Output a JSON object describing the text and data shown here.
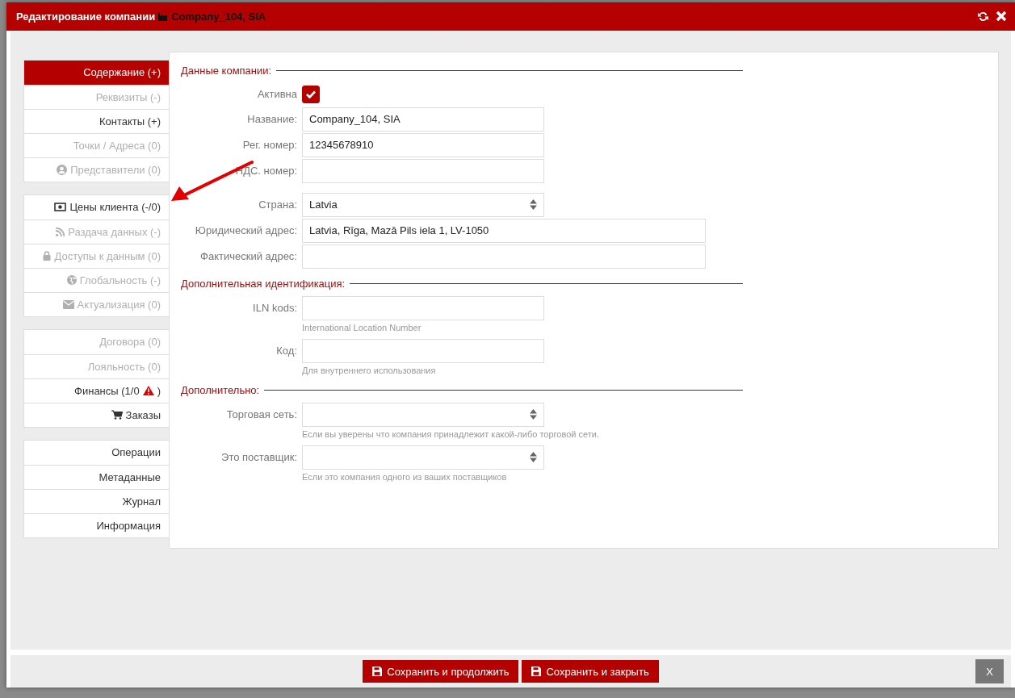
{
  "window": {
    "title": "Редактирование компании",
    "subject": "Company_104, SIA"
  },
  "sidebar": {
    "groups": [
      [
        {
          "label": "Содержание (+)",
          "selected": true,
          "disabled": false
        },
        {
          "label": "Реквизиты (-)",
          "selected": false,
          "disabled": true
        },
        {
          "label": "Контакты (+)",
          "selected": false,
          "disabled": false
        },
        {
          "label": "Точки / Адреса (0)",
          "selected": false,
          "disabled": true
        },
        {
          "label": "Представители (0)",
          "selected": false,
          "disabled": true
        }
      ],
      [
        {
          "label": "Цены клиента (-/0)",
          "selected": false,
          "disabled": false
        },
        {
          "label": "Раздача данных (-)",
          "selected": false,
          "disabled": true
        },
        {
          "label": "Доступы к данным (0)",
          "selected": false,
          "disabled": true
        },
        {
          "label": "Глобальность (-)",
          "selected": false,
          "disabled": true
        },
        {
          "label": "Актуализация (0)",
          "selected": false,
          "disabled": true
        }
      ],
      [
        {
          "label": "Договора (0)",
          "selected": false,
          "disabled": true
        },
        {
          "label": "Лояльность (0)",
          "selected": false,
          "disabled": true
        },
        {
          "label": "Финансы (1/0",
          "label_after": ")",
          "warning": true,
          "selected": false,
          "disabled": false
        },
        {
          "label": "Заказы",
          "selected": false,
          "disabled": false
        }
      ],
      [
        {
          "label": "Операции",
          "selected": false,
          "disabled": false
        },
        {
          "label": "Метаданные",
          "selected": false,
          "disabled": false
        },
        {
          "label": "Журнал",
          "selected": false,
          "disabled": false
        },
        {
          "label": "Информация",
          "selected": false,
          "disabled": false
        }
      ]
    ]
  },
  "form": {
    "sections": [
      {
        "title": "Данные компании:",
        "fields": [
          {
            "kind": "checkbox",
            "label": "Активна",
            "checked": true
          },
          {
            "kind": "text",
            "label": "Название:",
            "value": "Company_104, SIA"
          },
          {
            "kind": "text",
            "label": "Рег. номер:",
            "value": "12345678910"
          },
          {
            "kind": "text",
            "label": "НДС. номер:"
          },
          {
            "kind": "select",
            "label": "Страна:",
            "value": "Latvia",
            "gap_before": true
          },
          {
            "kind": "wide",
            "label": "Юридический адрес:",
            "value": "Latvia, Rīga, Mazā Pils iela 1, LV-1050"
          },
          {
            "kind": "wide",
            "label": "Фактический адрес:"
          }
        ]
      },
      {
        "title": "Дополнительная идентификация:",
        "fields": [
          {
            "kind": "text",
            "label": "ILN kods:",
            "hint": "International Location Number"
          },
          {
            "kind": "text",
            "label": "Код:",
            "hint": "Для внутреннего использования"
          }
        ]
      },
      {
        "title": "Дополнительно:",
        "fields": [
          {
            "kind": "select",
            "label": "Торговая сеть:",
            "hint": "Если вы уверены что компания принадлежит какой-либо торговой сети."
          },
          {
            "kind": "select",
            "label": "Это поставщик:",
            "hint": "Если это компания одного из ваших поставщиков"
          }
        ]
      }
    ]
  },
  "footer": {
    "buttons": [
      {
        "kind": "save",
        "label": "Сохранить и продолжить"
      },
      {
        "kind": "save",
        "label": "Сохранить и закрыть"
      },
      {
        "kind": "close",
        "label": "X"
      }
    ]
  }
}
